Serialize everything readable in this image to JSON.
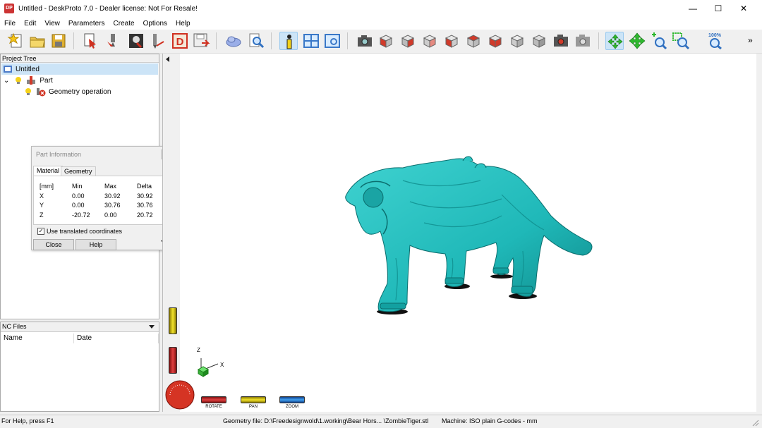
{
  "window": {
    "title": "Untitled - DeskProto 7.0 - Dealer license: Not For Resale!",
    "logo_text": "DP",
    "minimize": "—",
    "maximize": "☐",
    "close": "✕"
  },
  "menu": [
    "File",
    "Edit",
    "View",
    "Parameters",
    "Create",
    "Options",
    "Help"
  ],
  "toolbar": {
    "zoom_label": "100%",
    "icons": [
      "new-project-icon",
      "open-folder-icon",
      "save-icon",
      "part-wizard-icon",
      "operation-wizard-icon",
      "geometry-icon",
      "cutter-icon",
      "dealer-icon",
      "save-as-icon",
      "cloud-icon",
      "magnify-icon",
      "info-icon",
      "view-split-icon",
      "view-window-icon",
      "camera-icon",
      "view-front-icon",
      "view-back-icon",
      "view-left-icon",
      "view-right-icon",
      "view-top-icon",
      "view-bottom-icon",
      "view-iso1-icon",
      "view-iso2-icon",
      "render-icon",
      "render-alt-icon",
      "rotate-tool-icon",
      "pan-tool-icon",
      "zoom-in-tool-icon",
      "zoom-window-icon",
      "zoom-100-icon"
    ],
    "overflow": "»"
  },
  "project_tree": {
    "header": "Project Tree",
    "root": "Untitled",
    "part": "Part",
    "operation": "Geometry operation"
  },
  "part_info": {
    "title": "Part Information",
    "tabs": [
      "Material",
      "Geometry"
    ],
    "headers": [
      "[mm]",
      "Min",
      "Max",
      "Delta"
    ],
    "rows": [
      [
        "X",
        "0.00",
        "30.92",
        "30.92"
      ],
      [
        "Y",
        "0.00",
        "30.76",
        "30.76"
      ],
      [
        "Z",
        "-20.72",
        "0.00",
        "20.72"
      ]
    ],
    "checkbox_label": "Use translated coordinates",
    "checkbox_checked": true,
    "check_mark": "✓",
    "close_button": "Close",
    "help_button": "Help"
  },
  "nc_files": {
    "header": "NC Files",
    "columns": [
      "Name",
      "Date"
    ]
  },
  "viewport": {
    "model_color": "#1fb8b8",
    "axes": {
      "z": "Z",
      "x": "X"
    },
    "wheels": {
      "rotate": "ROTATE",
      "pan": "PAN",
      "zoom": "ZOOM"
    }
  },
  "statusbar": {
    "help": "For Help, press F1",
    "geometry_file": "Geometry file: D:\\Freedesignwold\\1.working\\Bear Hors... \\ZombieTiger.stl",
    "machine": "Machine: ISO plain G-codes - mm"
  }
}
